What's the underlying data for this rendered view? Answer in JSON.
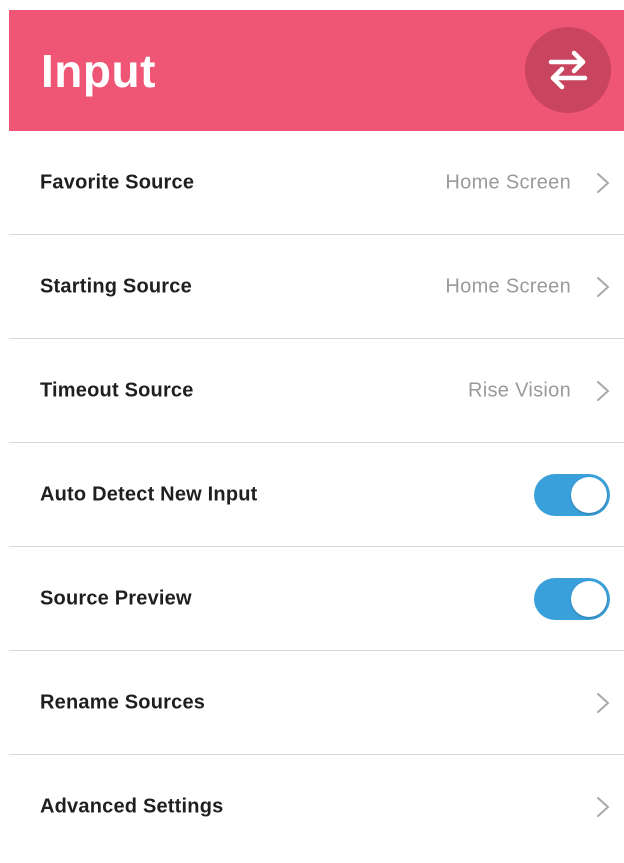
{
  "header": {
    "title": "Input",
    "swap_icon": "swap-arrows-icon",
    "background_color": "#ef5676",
    "button_color": "#c9455f"
  },
  "rows": [
    {
      "label": "Favorite Source",
      "value": "Home Screen",
      "control": "chevron"
    },
    {
      "label": "Starting Source",
      "value": "Home Screen",
      "control": "chevron"
    },
    {
      "label": "Timeout Source",
      "value": "Rise Vision",
      "control": "chevron"
    },
    {
      "label": "Auto Detect New Input",
      "control": "toggle",
      "on": true
    },
    {
      "label": "Source Preview",
      "control": "toggle",
      "on": true
    },
    {
      "label": "Rename Sources",
      "control": "chevron"
    },
    {
      "label": "Advanced Settings",
      "control": "chevron"
    }
  ],
  "colors": {
    "toggle_on": "#3aa0db",
    "label_text": "#1f1f1f",
    "value_text": "#9a9a9a",
    "divider": "#d9d9d9"
  }
}
